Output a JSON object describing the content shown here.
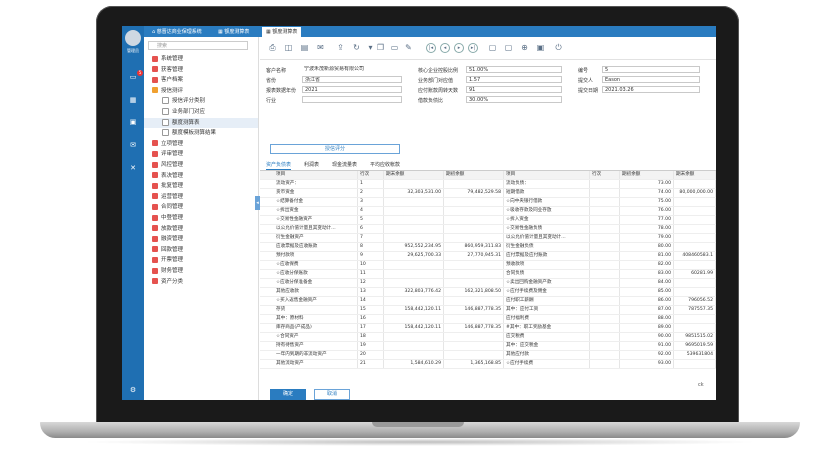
{
  "app": {
    "user_name": "管理员",
    "notify_count": "5"
  },
  "tabs": [
    {
      "label": "慈晋达商业保理系统"
    },
    {
      "label": "额度测算表"
    },
    {
      "label": "额度测算表"
    }
  ],
  "sidebar": {
    "search_placeholder": "搜索",
    "items": [
      {
        "label": "系统管理",
        "color": "#e5524f"
      },
      {
        "label": "获客管理",
        "color": "#e5524f"
      },
      {
        "label": "客户档案",
        "color": "#e5524f"
      },
      {
        "label": "授信测评",
        "color": "#f0a030"
      },
      {
        "label": "授信评分类别"
      },
      {
        "label": "业务部门对应"
      },
      {
        "label": "额度测算表"
      },
      {
        "label": "额度模板测算结果"
      },
      {
        "label": "立项管理",
        "color": "#e5524f"
      },
      {
        "label": "评审管理",
        "color": "#e5524f"
      },
      {
        "label": "风控管理",
        "color": "#e5524f"
      },
      {
        "label": "表决管理",
        "color": "#e5524f"
      },
      {
        "label": "批复管理",
        "color": "#e5524f"
      },
      {
        "label": "运营管理",
        "color": "#e5524f"
      },
      {
        "label": "合同管理",
        "color": "#e5524f"
      },
      {
        "label": "中登管理",
        "color": "#e5524f"
      },
      {
        "label": "放款管理",
        "color": "#e5524f"
      },
      {
        "label": "融资管理",
        "color": "#e5524f"
      },
      {
        "label": "回款管理",
        "color": "#e5524f"
      },
      {
        "label": "开票管理",
        "color": "#e5524f"
      },
      {
        "label": "财务管理",
        "color": "#e5524f"
      },
      {
        "label": "资产分类",
        "color": "#e5524f"
      }
    ]
  },
  "form": {
    "customer_label": "客户名称",
    "customer_value": "宁波禾茂新源贸易有限公司",
    "province_label": "省份",
    "province_value": "浙江省",
    "year_label": "报表数据年份",
    "year_value": "2021",
    "industry_label": "行业",
    "industry_value": "",
    "ratio_label": "核心企业控股比例",
    "ratio_value": "51.00%",
    "dept_label": "业务部门对应值",
    "dept_value": "1.57",
    "days_label": "应付账款周转天数",
    "days_value": "91",
    "loan_label": "借款负债比",
    "loan_value": "30.00%",
    "code_label": "编号",
    "code_value": "5",
    "submitter_label": "提交人",
    "submitter_value": "Eason",
    "date_label": "提交日期",
    "date_value": "2021.03.26",
    "eval_button": "授信评分"
  },
  "subtabs": [
    "资产负债表",
    "利润表",
    "现金流量表",
    "平均应收帐款"
  ],
  "table": {
    "headers": [
      "项目",
      "行次",
      "期末余额",
      "期初余额",
      "项目",
      "行次",
      "期初余额",
      "期末余额"
    ],
    "rows": [
      [
        "流动资产：",
        "1",
        "",
        "",
        "流动负债：",
        "",
        "73.00",
        ""
      ],
      [
        "货币资金",
        "2",
        "32,303,531.00",
        "79,482,529.58",
        "短期借款",
        "",
        "74.00",
        "80,000,000.00"
      ],
      [
        "☆结算备付金",
        "3",
        "",
        "",
        "☆向中央银行借款",
        "",
        "75.00",
        ""
      ],
      [
        "☆拆出资金",
        "4",
        "",
        "",
        "☆吸收存款及同业存放",
        "",
        "76.00",
        ""
      ],
      [
        "☆交易性金融资产",
        "5",
        "",
        "",
        "☆拆入资金",
        "",
        "77.00",
        ""
      ],
      [
        "以公允价值计量且其变动计…",
        "6",
        "",
        "",
        "☆交易性金融负债",
        "",
        "78.00",
        ""
      ],
      [
        "衍生金融资产",
        "7",
        "",
        "",
        "以公允价值计量且其变动计…",
        "",
        "79.00",
        ""
      ],
      [
        "应收票据及应收账款",
        "8",
        "952,552,234.95",
        "860,959,311.83",
        "衍生金融负债",
        "",
        "80.00",
        ""
      ],
      [
        "预付款项",
        "9",
        "29,625,700.33",
        "27,770,945.31",
        "应付票据及应付账款",
        "",
        "81.00",
        "$34,885,044.03"
      ],
      [
        "☆应收保费",
        "10",
        "",
        "",
        "预收款项",
        "",
        "82.00",
        ""
      ],
      [
        "☆应收分保账款",
        "11",
        "",
        "",
        "合同负债",
        "",
        "83.00",
        "16,933.17"
      ],
      [
        "☆应收分保准备金",
        "12",
        "",
        "",
        "☆卖出回购金融资产款",
        "",
        "84.00",
        ""
      ],
      [
        "其他应收款",
        "13",
        "322,803,776.42",
        "162,321,808.50",
        "☆应付手续费及佣金",
        "",
        "85.00",
        ""
      ],
      [
        "☆买入返售金融资产",
        "14",
        "",
        "",
        "应付职工薪酬",
        "",
        "86.00",
        "12,985.52"
      ],
      [
        "存货",
        "15",
        "158,442,120.11",
        "146,887,778.35",
        "其中：应付工资",
        "",
        "87.00",
        "4,486.35"
      ],
      [
        "其中：原材料",
        "16",
        "",
        "",
        "应付福利费",
        "",
        "88.00",
        ""
      ],
      [
        "库存商品(产成品)",
        "17",
        "158,442,120.11",
        "146,887,778.35",
        "#其中：职工奖励基金",
        "",
        "89.00",
        ""
      ],
      [
        "☆合同资产",
        "18",
        "",
        "",
        "应交税费",
        "",
        "90.00",
        "12,603,728.44"
      ],
      [
        "持有待售资产",
        "19",
        "",
        "",
        "其中：应交税金",
        "",
        "91.00",
        "12,490,974.85"
      ],
      [
        "一年内到期的非流动资产",
        "20",
        "",
        "",
        "其他应付款",
        "",
        "92.00",
        "590,135,518.04"
      ],
      [
        "其他流动资产",
        "21",
        "1,584,610.29",
        "1,365,168.85",
        "☆应付手续费",
        "",
        "93.00",
        ""
      ]
    ],
    "extra_col": [
      "",
      "",
      "",
      "",
      "",
      "",
      "",
      "",
      "408460583.1",
      "",
      "60281.99",
      "",
      "",
      "796056.52",
      "787557.35",
      "",
      "",
      "9851515.02",
      "9695019.59",
      "539631804",
      ""
    ]
  },
  "footer": {
    "ok": "确定",
    "cancel": "取消",
    "ck": "ck"
  }
}
